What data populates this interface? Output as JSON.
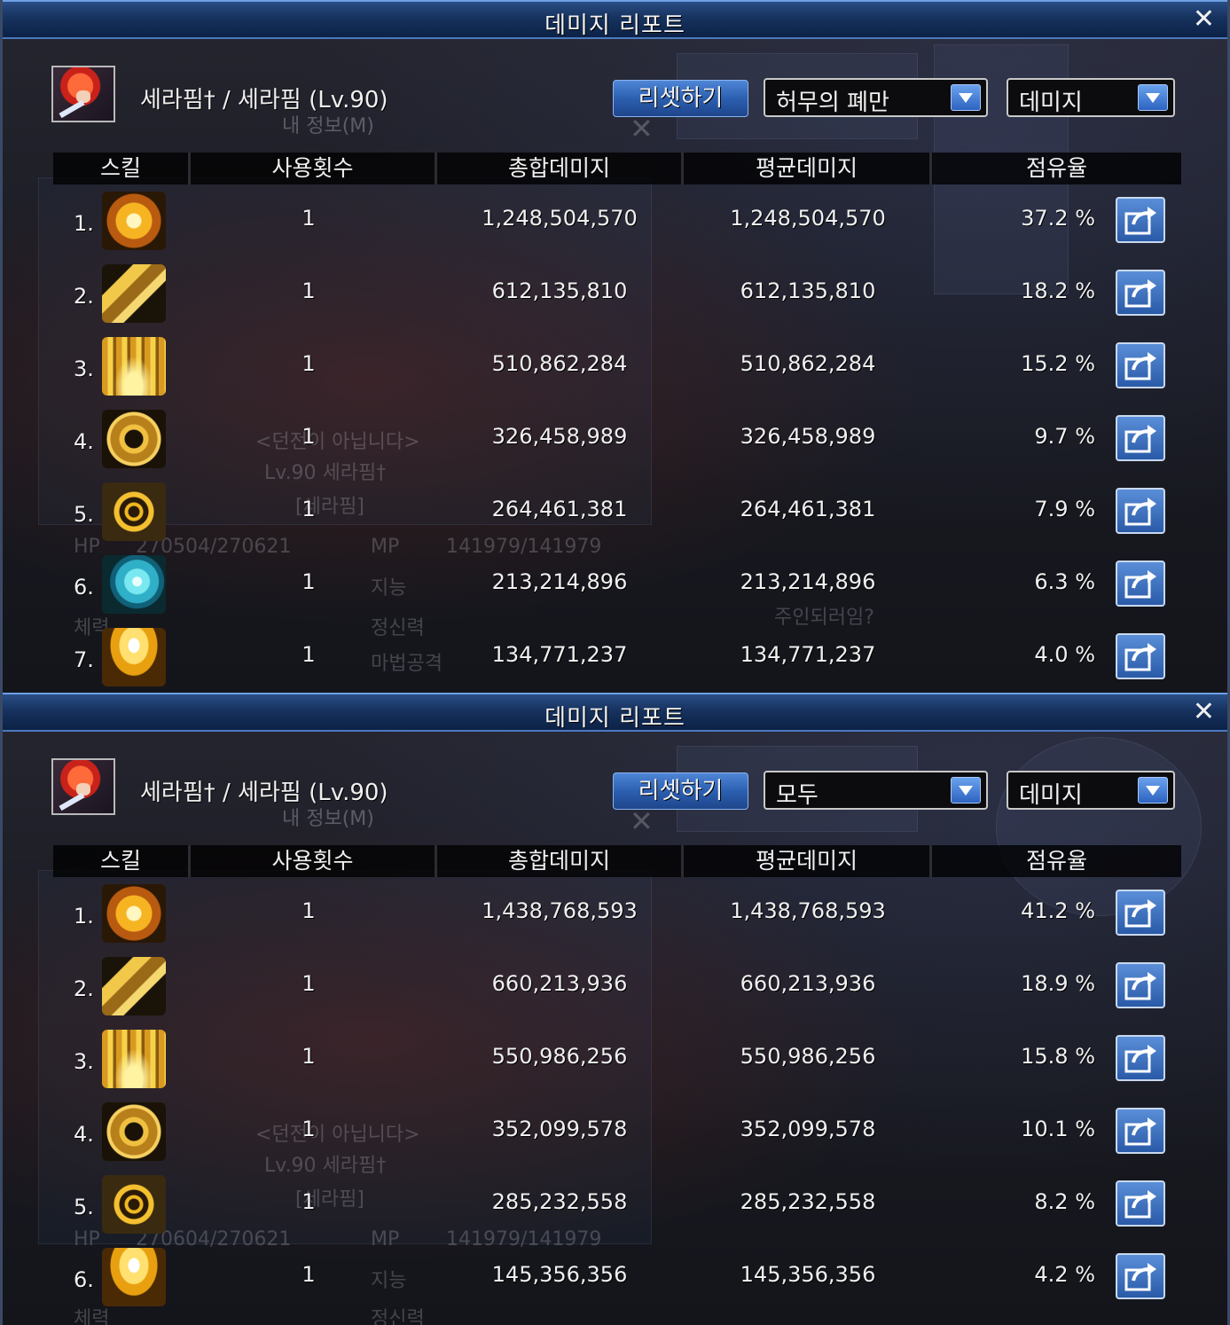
{
  "panels": [
    {
      "title": "데미지 리포트",
      "character": "세라핌† / 세라핌 (Lv.90)",
      "subtitle": "내 정보(M)",
      "reset_label": "리셋하기",
      "dungeon_select": "허무의 폐만",
      "type_select": "데미지",
      "columns": [
        "스킬",
        "사용횟수",
        "총합데미지",
        "평균데미지",
        "점유율"
      ],
      "rows": [
        {
          "rank": "1.",
          "icon": "sun-burst-skill-icon",
          "count": "1",
          "total": "1,248,504,570",
          "avg": "1,248,504,570",
          "share": "37.2 %"
        },
        {
          "rank": "2.",
          "icon": "golden-lance-skill-icon",
          "count": "1",
          "total": "612,135,810",
          "avg": "612,135,810",
          "share": "18.2 %"
        },
        {
          "rank": "3.",
          "icon": "light-pillar-skill-icon",
          "count": "1",
          "total": "510,862,284",
          "avg": "510,862,284",
          "share": "15.2 %"
        },
        {
          "rank": "4.",
          "icon": "holy-shield-skill-icon",
          "count": "1",
          "total": "326,458,989",
          "avg": "326,458,989",
          "share": "9.7 %"
        },
        {
          "rank": "5.",
          "icon": "cross-target-skill-icon",
          "count": "1",
          "total": "264,461,381",
          "avg": "264,461,381",
          "share": "7.9 %"
        },
        {
          "rank": "6.",
          "icon": "cyan-swirl-skill-icon",
          "count": "1",
          "total": "213,214,896",
          "avg": "213,214,896",
          "share": "6.3 %"
        },
        {
          "rank": "7.",
          "icon": "light-burst-skill-icon",
          "count": "1",
          "total": "134,771,237",
          "avg": "134,771,237",
          "share": "4.0 %"
        }
      ]
    },
    {
      "title": "데미지 리포트",
      "character": "세라핌† / 세라핌 (Lv.90)",
      "subtitle": "내 정보(M)",
      "reset_label": "리셋하기",
      "dungeon_select": "모두",
      "type_select": "데미지",
      "columns": [
        "스킬",
        "사용횟수",
        "총합데미지",
        "평균데미지",
        "점유율"
      ],
      "rows": [
        {
          "rank": "1.",
          "icon": "sun-burst-skill-icon",
          "count": "1",
          "total": "1,438,768,593",
          "avg": "1,438,768,593",
          "share": "41.2 %"
        },
        {
          "rank": "2.",
          "icon": "golden-lance-skill-icon",
          "count": "1",
          "total": "660,213,936",
          "avg": "660,213,936",
          "share": "18.9 %"
        },
        {
          "rank": "3.",
          "icon": "light-pillar-skill-icon",
          "count": "1",
          "total": "550,986,256",
          "avg": "550,986,256",
          "share": "15.8 %"
        },
        {
          "rank": "4.",
          "icon": "holy-shield-skill-icon",
          "count": "1",
          "total": "352,099,578",
          "avg": "352,099,578",
          "share": "10.1 %"
        },
        {
          "rank": "5.",
          "icon": "cross-target-skill-icon",
          "count": "1",
          "total": "285,232,558",
          "avg": "285,232,558",
          "share": "8.2 %"
        },
        {
          "rank": "6.",
          "icon": "light-burst-skill-icon",
          "count": "1",
          "total": "145,356,356",
          "avg": "145,356,356",
          "share": "4.2 %"
        }
      ]
    }
  ],
  "background_ghost_text": {
    "panel1": [
      "HP",
      "270504/270621",
      "MP",
      "141979/141979",
      "지능",
      "체력",
      "정신력",
      "마법공격",
      "Lv.90 세라핌†",
      "[세라핌]",
      "<던전이 아닙니다>",
      "주인되러임?"
    ],
    "panel2": [
      "HP",
      "270604/270621",
      "MP",
      "141979/141979",
      "지능",
      "체력",
      "정신력",
      "Lv.90 세라핌†",
      "[세라핌]",
      "<던전이 아닙니다>"
    ]
  },
  "colors": {
    "titlebar": "#16325e",
    "button_blue": "#2c5fb0",
    "header_bg": "#000000"
  },
  "close_icon": "✕"
}
